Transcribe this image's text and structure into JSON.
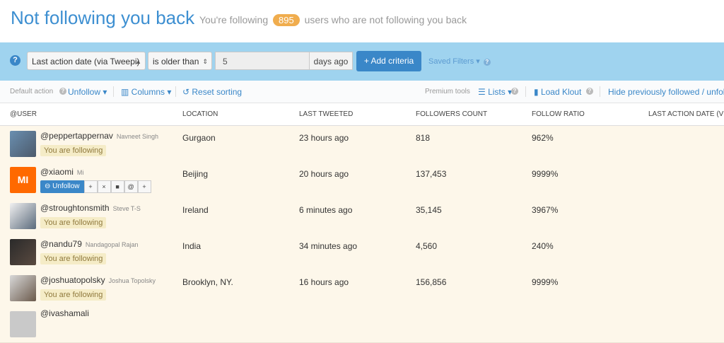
{
  "header": {
    "title": "Not following you back",
    "subtitle_pre": "You're following",
    "count": "895",
    "subtitle_post": "users who are not following you back"
  },
  "filter": {
    "help_icon": "?",
    "field": "Last action date (via Tweepi)",
    "operator": "is older than",
    "value": "5",
    "unit": "days ago",
    "add_button": "+ Add criteria",
    "saved_filters": "Saved Filters ▾"
  },
  "toolbar": {
    "default_action_label": "Default action",
    "unfollow": "Unfollow ▾",
    "columns": "Columns ▾",
    "reset": "Reset sorting",
    "premium_label": "Premium tools",
    "lists": "Lists ▾",
    "load_klout": "Load Klout",
    "hide_prev": "Hide previously followed / unfollo"
  },
  "table": {
    "headers": [
      "@USER",
      "LOCATION",
      "LAST TWEETED",
      "FOLLOWERS COUNT",
      "FOLLOW RATIO",
      "LAST ACTION DATE (VIA"
    ],
    "rows": [
      {
        "handle": "@peppertappernav",
        "name": "Navneet Singh",
        "badge": "You are following",
        "location": "Gurgaon",
        "last_tweeted": "23 hours ago",
        "followers": "818",
        "ratio": "962%"
      },
      {
        "handle": "@xiaomi",
        "name": "Mi",
        "badge": "",
        "location": "Beijing",
        "last_tweeted": "20 hours ago",
        "followers": "137,453",
        "ratio": "9999%"
      },
      {
        "handle": "@stroughtonsmith",
        "name": "Steve T-S",
        "badge": "You are following",
        "location": "Ireland",
        "last_tweeted": "6 minutes ago",
        "followers": "35,145",
        "ratio": "3967%"
      },
      {
        "handle": "@nandu79",
        "name": "Nandagopal Rajan",
        "badge": "You are following",
        "location": "India",
        "last_tweeted": "34 minutes ago",
        "followers": "4,560",
        "ratio": "240%"
      },
      {
        "handle": "@joshuatopolsky",
        "name": "Joshua Topolsky",
        "badge": "You are following",
        "location": "Brooklyn, NY.",
        "last_tweeted": "16 hours ago",
        "followers": "156,856",
        "ratio": "9999%"
      }
    ],
    "row_actions": {
      "unfollow": "Unfollow"
    },
    "partial_row_handle": "@ivashamali"
  },
  "brand": {
    "mi_text": "MI"
  }
}
